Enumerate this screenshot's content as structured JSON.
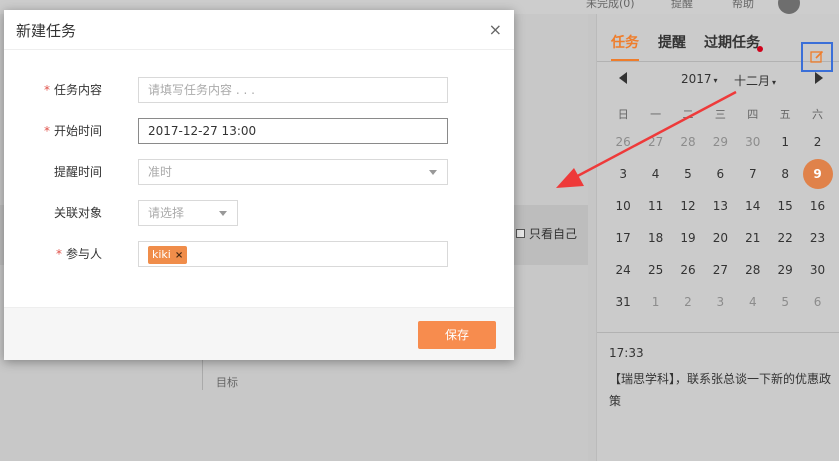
{
  "background": {
    "topbar": {
      "items": [
        "未完成(0)",
        "提醒",
        "帮助"
      ]
    },
    "filter_label": "只看自己",
    "target_label": "目标"
  },
  "calendar": {
    "tabs": [
      "任务",
      "提醒",
      "过期任务"
    ],
    "active_tab": "任务",
    "edit_icon": "edit-icon",
    "year": "2017",
    "month": "十二月",
    "weekdays": [
      "日",
      "一",
      "二",
      "三",
      "四",
      "五",
      "六"
    ],
    "weeks": [
      [
        "26",
        "27",
        "28",
        "29",
        "30",
        "1",
        "2"
      ],
      [
        "3",
        "4",
        "5",
        "6",
        "7",
        "8",
        "9"
      ],
      [
        "10",
        "11",
        "12",
        "13",
        "14",
        "15",
        "16"
      ],
      [
        "17",
        "18",
        "19",
        "20",
        "21",
        "22",
        "23"
      ],
      [
        "24",
        "25",
        "26",
        "27",
        "28",
        "29",
        "30"
      ],
      [
        "31",
        "1",
        "2",
        "3",
        "4",
        "5",
        "6"
      ]
    ],
    "today": "9",
    "event": {
      "time": "17:33",
      "description": "【瑞思学科】，联系张总谈一下新的优惠政策"
    },
    "colors": {
      "accent": "#ef7d2b",
      "highlight_border": "#3a6fd8",
      "dot": "#d0021b"
    }
  },
  "modal": {
    "title": "新建任务",
    "close_label": "×",
    "fields": {
      "content": {
        "label": "任务内容",
        "required": true,
        "placeholder": "请填写任务内容 . . ."
      },
      "start_time": {
        "label": "开始时间",
        "required": true,
        "value": "2017-12-27 13:00"
      },
      "reminder": {
        "label": "提醒时间",
        "required": false,
        "value": "准时"
      },
      "related": {
        "label": "关联对象",
        "required": false,
        "placeholder": "请选择"
      },
      "participants": {
        "label": "参与人",
        "required": true,
        "tags": [
          "kiki"
        ]
      }
    },
    "save_label": "保存",
    "required_mark": "*",
    "tag_remove": "×"
  }
}
